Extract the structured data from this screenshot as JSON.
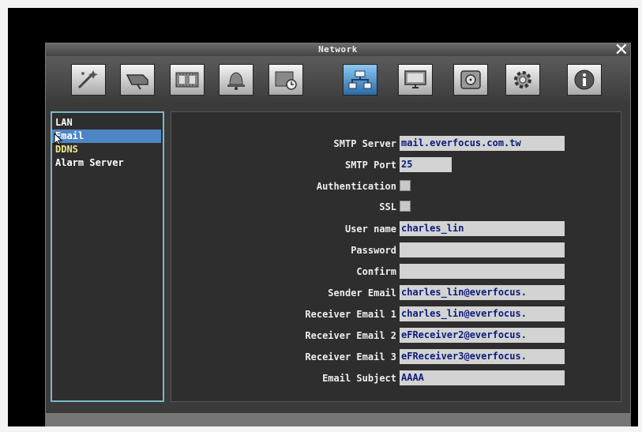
{
  "window": {
    "title": "Network"
  },
  "toolbar": {
    "tabs": [
      {
        "icon": "wizard-icon",
        "active": false
      },
      {
        "icon": "camera-icon",
        "active": false
      },
      {
        "icon": "film-record-icon",
        "active": false
      },
      {
        "icon": "alarm-bell-icon",
        "active": false
      },
      {
        "icon": "schedule-icon",
        "active": false
      },
      {
        "icon": "network-icon",
        "active": true
      },
      {
        "icon": "monitor-icon",
        "active": false
      },
      {
        "icon": "disk-icon",
        "active": false
      },
      {
        "icon": "system-gear-icon",
        "active": false
      },
      {
        "icon": "info-icon",
        "active": false
      }
    ]
  },
  "sidebar": {
    "items": [
      {
        "label": "LAN"
      },
      {
        "label": "Email"
      },
      {
        "label": "DDNS"
      },
      {
        "label": "Alarm Server"
      }
    ]
  },
  "form": {
    "smtp_server_label": "SMTP Server",
    "smtp_server_value": "mail.everfocus.com.tw",
    "smtp_port_label": "SMTP Port",
    "smtp_port_value": "25",
    "authentication_label": "Authentication",
    "ssl_label": "SSL",
    "username_label": "User name",
    "username_value": "charles_lin",
    "password_label": "Password",
    "password_value": "",
    "confirm_label": "Confirm",
    "confirm_value": "",
    "sender_email_label": "Sender Email",
    "sender_email_value": "charles_lin@everfocus.",
    "receiver_email_1_label": "Receiver Email 1",
    "receiver_email_1_value": "charles_lin@everfocus.",
    "receiver_email_2_label": "Receiver Email 2",
    "receiver_email_2_value": "eFReceiver2@everfocus.",
    "receiver_email_3_label": "Receiver Email 3",
    "receiver_email_3_value": "eFReceiver3@everfocus.",
    "email_subject_label": "Email Subject",
    "email_subject_value": "AAAA"
  },
  "colors": {
    "selection": "#4d86c5",
    "sidebar_border": "#79b9c8",
    "field_text": "#0b1c7a",
    "ddns_text": "#f0e68c"
  }
}
